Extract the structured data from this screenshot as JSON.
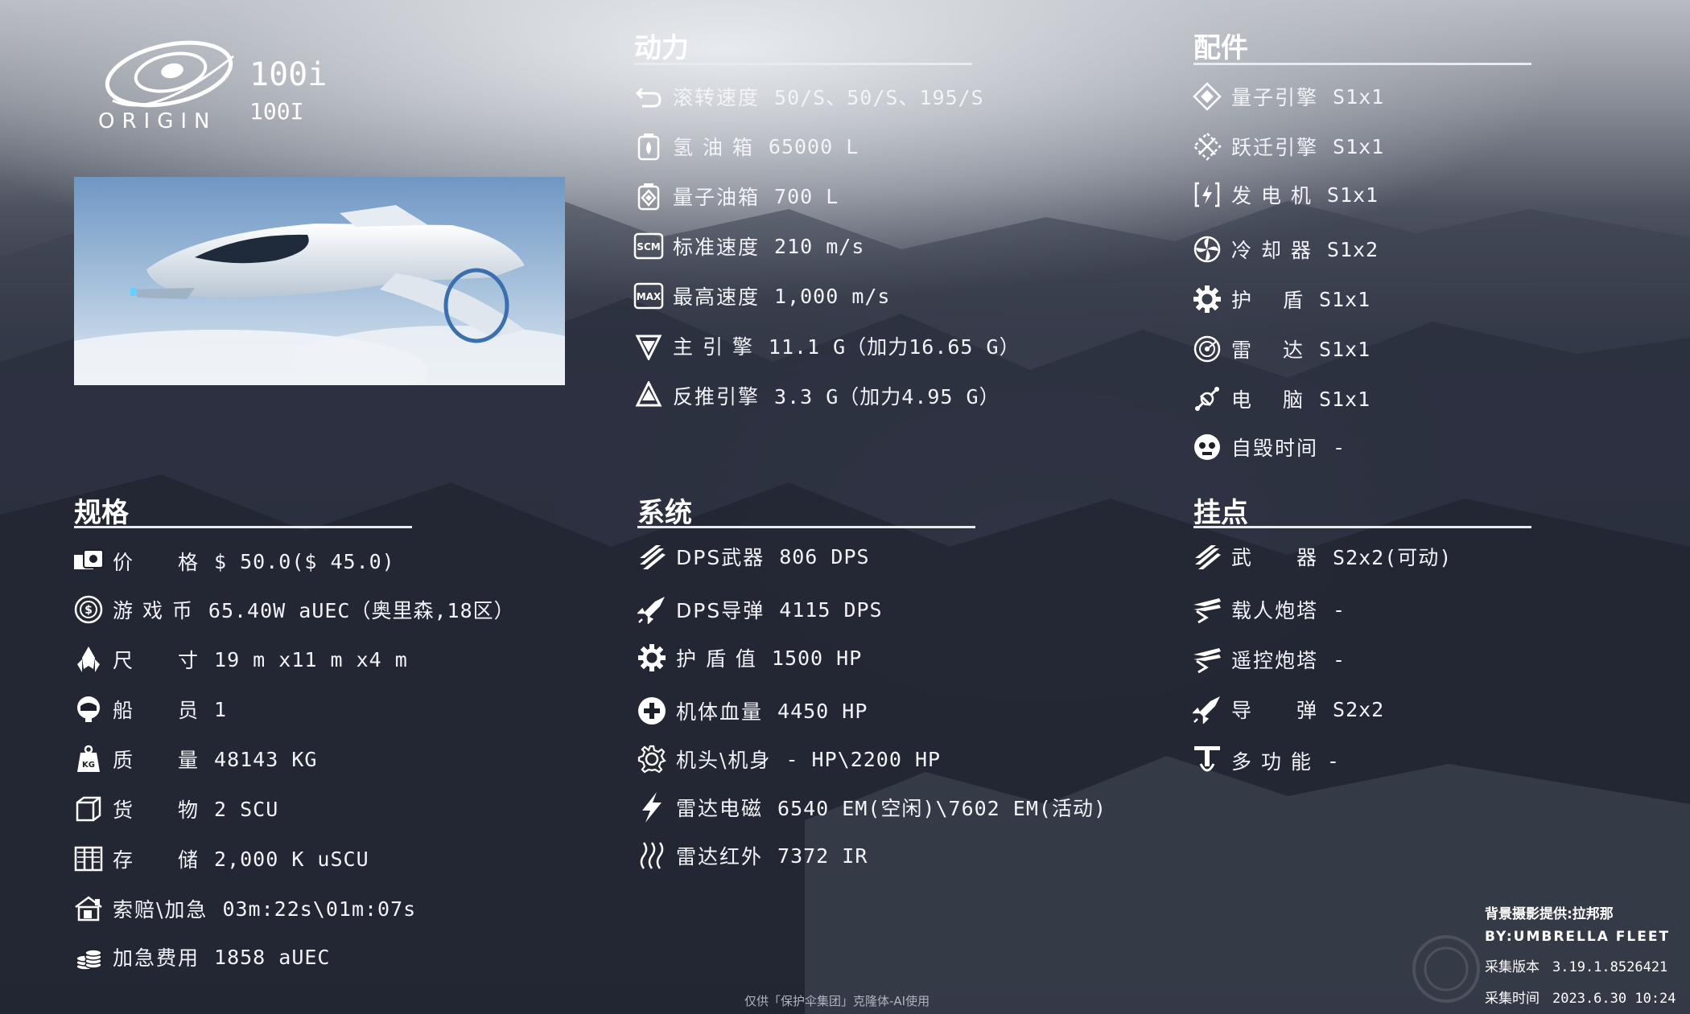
{
  "brand": {
    "logo_text": "ORIGIN",
    "model_name": "100i",
    "model_code": "100I"
  },
  "sections": {
    "power_title": "动力",
    "parts_title": "配件",
    "spec_title": "规格",
    "system_title": "系统",
    "hardpoint_title": "挂点"
  },
  "power": [
    {
      "icon": "roll-arrow-icon",
      "label": "滚转速度",
      "value": "50/S、50/S、195/S"
    },
    {
      "icon": "hydrogen-tank-icon",
      "label": "氢 油 箱",
      "value": "65000 L"
    },
    {
      "icon": "quantum-tank-icon",
      "label": "量子油箱",
      "value": "700 L"
    },
    {
      "icon": "scm-speed-icon",
      "label": "标准速度",
      "value": "210 m/s"
    },
    {
      "icon": "max-speed-icon",
      "label": "最高速度",
      "value": "1,000 m/s"
    },
    {
      "icon": "main-thruster-icon",
      "label": "主 引 擎",
      "value": "11.1 G（加力16.65 G）"
    },
    {
      "icon": "retro-thruster-icon",
      "label": "反推引擎",
      "value": "3.3 G（加力4.95 G）"
    }
  ],
  "parts": [
    {
      "icon": "quantum-drive-icon",
      "label": "量子引擎",
      "value": "S1x1"
    },
    {
      "icon": "jump-drive-icon",
      "label": "跃迁引擎",
      "value": "S1x1"
    },
    {
      "icon": "power-plant-icon",
      "label": "发 电 机",
      "value": "S1x1"
    },
    {
      "icon": "cooler-icon",
      "label": "冷 却 器",
      "value": "S1x2"
    },
    {
      "icon": "shield-icon",
      "label": "护　 盾",
      "value": "S1x1"
    },
    {
      "icon": "radar-icon",
      "label": "雷　 达",
      "value": "S1x1"
    },
    {
      "icon": "computer-icon",
      "label": "电　 脑",
      "value": "S1x1"
    },
    {
      "icon": "self-destruct-icon",
      "label": "自毁时间",
      "value": "-"
    }
  ],
  "specs": [
    {
      "icon": "price-icon",
      "label": "价　　格",
      "value": "$ 50.0($ 45.0)"
    },
    {
      "icon": "coin-icon",
      "label": "游 戏 币",
      "value": "65.40W aUEC（奥里森,18区）"
    },
    {
      "icon": "size-icon",
      "label": "尺　　寸",
      "value": "19 m x11 m x4 m"
    },
    {
      "icon": "crew-icon",
      "label": "船　　员",
      "value": "1"
    },
    {
      "icon": "mass-icon",
      "mass_label": "KG",
      "label": "质　　量",
      "value": "48143 KG"
    },
    {
      "icon": "cargo-icon",
      "label": "货　　物",
      "value": "2 SCU"
    },
    {
      "icon": "storage-icon",
      "label": "存　　储",
      "value": "2,000 K uSCU"
    },
    {
      "icon": "claim-icon",
      "label": "索赔\\加急",
      "value": "03m:22s\\01m:07s"
    },
    {
      "icon": "expedite-fee-icon",
      "label": "加急费用",
      "value": "1858 aUEC"
    }
  ],
  "system": [
    {
      "icon": "weapon-dps-icon",
      "label": "DPS武器",
      "value": "806 DPS"
    },
    {
      "icon": "missile-dps-icon",
      "label": "DPS导弹",
      "value": "4115 DPS"
    },
    {
      "icon": "shield-hp-icon",
      "label": "护 盾 值",
      "value": "1500 HP"
    },
    {
      "icon": "hull-hp-icon",
      "label": "机体血量",
      "value": "4450 HP"
    },
    {
      "icon": "gear-icon",
      "label": "机头\\机身",
      "value": "- HP\\2200 HP"
    },
    {
      "icon": "lightning-icon",
      "label": "雷达电磁",
      "value": "6540 EM(空闲)\\7602 EM(活动)"
    },
    {
      "icon": "heat-icon",
      "label": "雷达红外",
      "value": "7372 IR"
    }
  ],
  "hardpoints": [
    {
      "icon": "weapon-icon",
      "label": "武　　器",
      "value": "S2x2(可动)"
    },
    {
      "icon": "manned-turret-icon",
      "label": "载人炮塔",
      "value": "-"
    },
    {
      "icon": "remote-turret-icon",
      "label": "遥控炮塔",
      "value": "-"
    },
    {
      "icon": "missile-icon",
      "label": "导　　弹",
      "value": "S2x2"
    },
    {
      "icon": "utility-icon",
      "label": "多 功 能",
      "value": "-"
    }
  ],
  "credits": {
    "photo": "背景摄影提供:拉邦那",
    "by": "BY:UMBRELLA FLEET",
    "version_label": "采集版本",
    "version": "3.19.1.8526421",
    "time_label": "采集时间",
    "time": "2023.6.30 10:24"
  },
  "footer": "仅供「保护伞集团」克隆体-AI使用",
  "colors": {
    "text": "#f2f4f7",
    "line": "#e8ebef",
    "background": "#1b1e2b"
  }
}
